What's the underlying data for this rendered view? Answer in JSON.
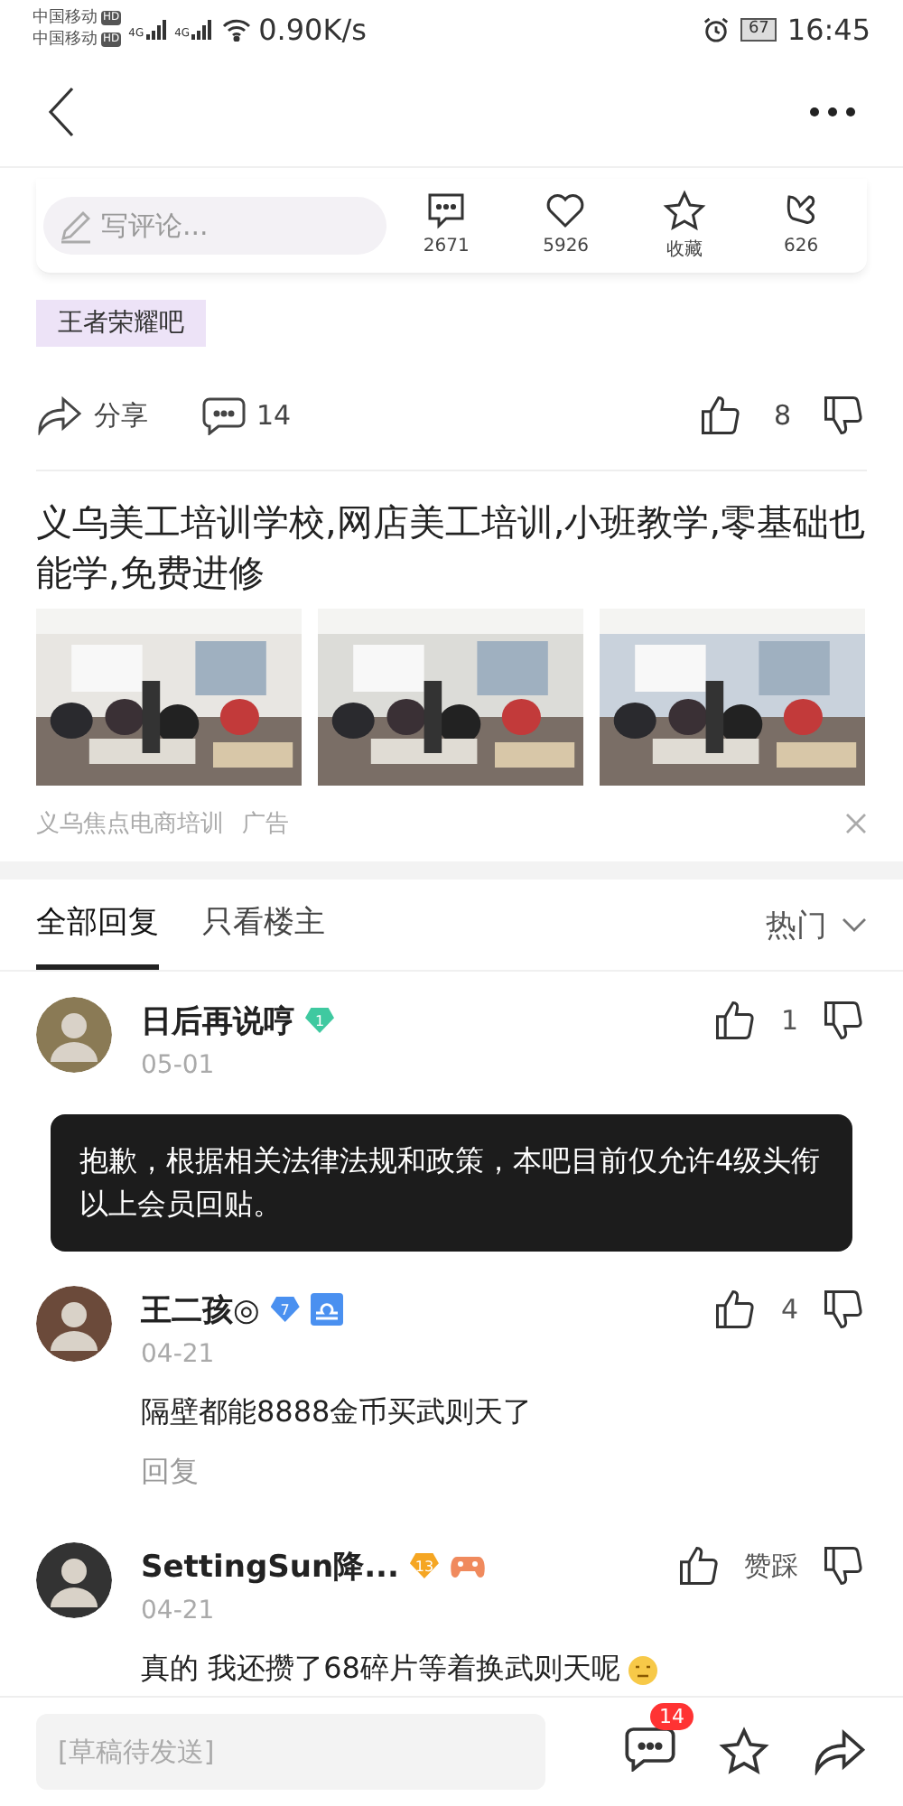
{
  "status_bar": {
    "carriers": [
      {
        "name": "中国移动",
        "badge": "HD"
      },
      {
        "name": "中国移动",
        "badge": "HD"
      }
    ],
    "signals": [
      "4G",
      "4G"
    ],
    "network_speed": "0.90K/s",
    "battery": "67",
    "time": "16:45"
  },
  "post_bar": {
    "comment_placeholder": "写评论...",
    "stats": [
      {
        "kind": "comment",
        "label": "2671"
      },
      {
        "kind": "like",
        "label": "5926"
      },
      {
        "kind": "favorite",
        "label": "收藏"
      },
      {
        "kind": "reward",
        "label": "626"
      }
    ]
  },
  "forum_tag": "王者荣耀吧",
  "post_actions": {
    "share": "分享",
    "comments": "14",
    "likes": "8"
  },
  "ad": {
    "title": "义乌美工培训学校,网店美工培训,小班教学,零基础也能学,免费进修",
    "source": "义乌焦点电商培训",
    "label": "广告"
  },
  "reply_tabs": [
    {
      "label": "全部回复",
      "selected": true
    },
    {
      "label": "只看楼主",
      "selected": false
    }
  ],
  "sort": "热门",
  "comments": [
    {
      "name": "日后再说哼",
      "level": "1",
      "color": "#3fc9a0",
      "kind": "plain",
      "date": "05-01",
      "likes": "1"
    },
    {
      "name": "王二孩◎",
      "level": "7",
      "color": "#4a90f0",
      "kind": "zodiac",
      "date": "04-21",
      "likes": "4",
      "text": "隔壁都能8888金币买武则天了",
      "reply": "回复"
    },
    {
      "name": "SettingSun降...",
      "level": "13",
      "color": "#f5a623",
      "kind": "game",
      "date": "04-21",
      "likes": "赞踩",
      "text": "真的 我还攒了68碎片等着换武则天呢",
      "emoji": true
    }
  ],
  "toast": "抱歉，根据相关法律法规和政策，本吧目前仅允许4级头衔以上会员回贴。",
  "bottom_bar": {
    "draft_placeholder": "[草稿待发送]",
    "comment_badge": "14"
  }
}
